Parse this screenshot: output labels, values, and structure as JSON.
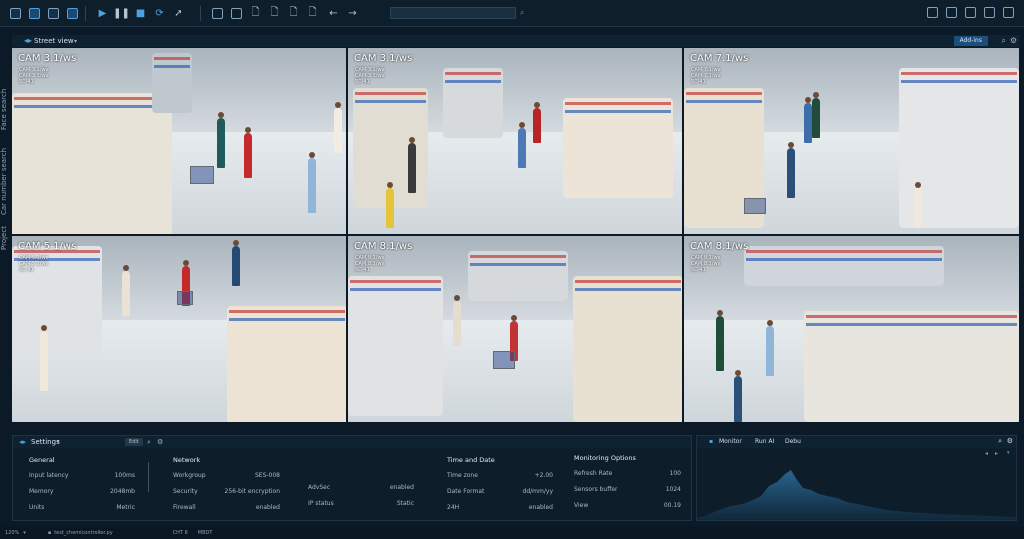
{
  "toolbar": {
    "left_icons": [
      "window-icon",
      "import-icon",
      "save-icon",
      "chart-icon"
    ],
    "play_icons": [
      "play-icon",
      "pause-icon",
      "stop-icon",
      "refresh-icon",
      "pointer-icon"
    ],
    "doc_icons": [
      "layout-icon",
      "copy-icon",
      "document-icon",
      "document-edit-icon",
      "document-export-icon",
      "delete-document-icon"
    ],
    "nav_icons": [
      "back-arrow-icon",
      "forward-arrow-icon"
    ],
    "right_icons": [
      "upload-icon",
      "download-icon",
      "minimize-icon",
      "maximize-icon",
      "trash-icon"
    ],
    "search_icon": "search-icon"
  },
  "side_tabs": [
    "Face search",
    "Car number search",
    "Project"
  ],
  "view": {
    "title": "Street view",
    "addins_label": "Add-ins"
  },
  "cameras": [
    {
      "label": "CAM 3.1/ws",
      "sub": [
        "CAM 3.1/ws",
        "CAM 3.1/ws",
        "SC-41"
      ]
    },
    {
      "label": "CAM 3.1/ws",
      "sub": [
        "CAM 3.1/ws",
        "CAM 3.1/ws",
        "SC-41"
      ]
    },
    {
      "label": "CAM 7.1/ws",
      "sub": [
        "CAM 7.1/ws",
        "CAM 7.1/ws",
        "SC-41"
      ]
    },
    {
      "label": "CAM 5.1/ws",
      "sub": [
        "CAM 5.1/ws",
        "CAM 5.1/ws",
        "SC-41"
      ]
    },
    {
      "label": "CAM 8.1/ws",
      "sub": [
        "CAM 8.1/ws",
        "CAM 8.1/ws",
        "SC-41"
      ]
    },
    {
      "label": "CAM 8.1/ws",
      "sub": [
        "CAM 8.1/ws",
        "CAM 8.1/ws",
        "SC-41"
      ]
    }
  ],
  "settings": {
    "title": "Settings",
    "edit_label": "Edit",
    "general": {
      "heading": "General",
      "rows": [
        {
          "k": "Input latency",
          "v": "100ms"
        },
        {
          "k": "Memory",
          "v": "2048mb"
        },
        {
          "k": "Units",
          "v": "Metric"
        }
      ]
    },
    "network": {
      "heading": "Network",
      "rows": [
        {
          "k": "Workgroup",
          "v": "SES-008"
        },
        {
          "k": "Security",
          "v": "256-bit encryption"
        },
        {
          "k": "Firewall",
          "v": "enabled"
        }
      ],
      "extra": [
        {
          "k": "AdvSec",
          "v": "enabled"
        },
        {
          "k": "IP status",
          "v": "Static"
        }
      ]
    },
    "time": {
      "heading": "Time and Date",
      "rows": [
        {
          "k": "Time zone",
          "v": "+2.00"
        },
        {
          "k": "Date Format",
          "v": "dd/mm/yy"
        },
        {
          "k": "24H",
          "v": "enabled"
        }
      ]
    },
    "monitoring": {
      "heading": "Monitoring Options",
      "rows": [
        {
          "k": "Refresh Rate",
          "v": "100"
        },
        {
          "k": "Sensors buffer",
          "v": "1024"
        },
        {
          "k": "View",
          "v": "00.19"
        }
      ]
    }
  },
  "monitor": {
    "tabs": [
      "Monitor",
      "Run AI",
      "Debu"
    ]
  },
  "status_bar": {
    "zoom": "120%",
    "file": "test_chemicontroller.py",
    "mode": "CHT 8",
    "encoding": "MBDT"
  }
}
